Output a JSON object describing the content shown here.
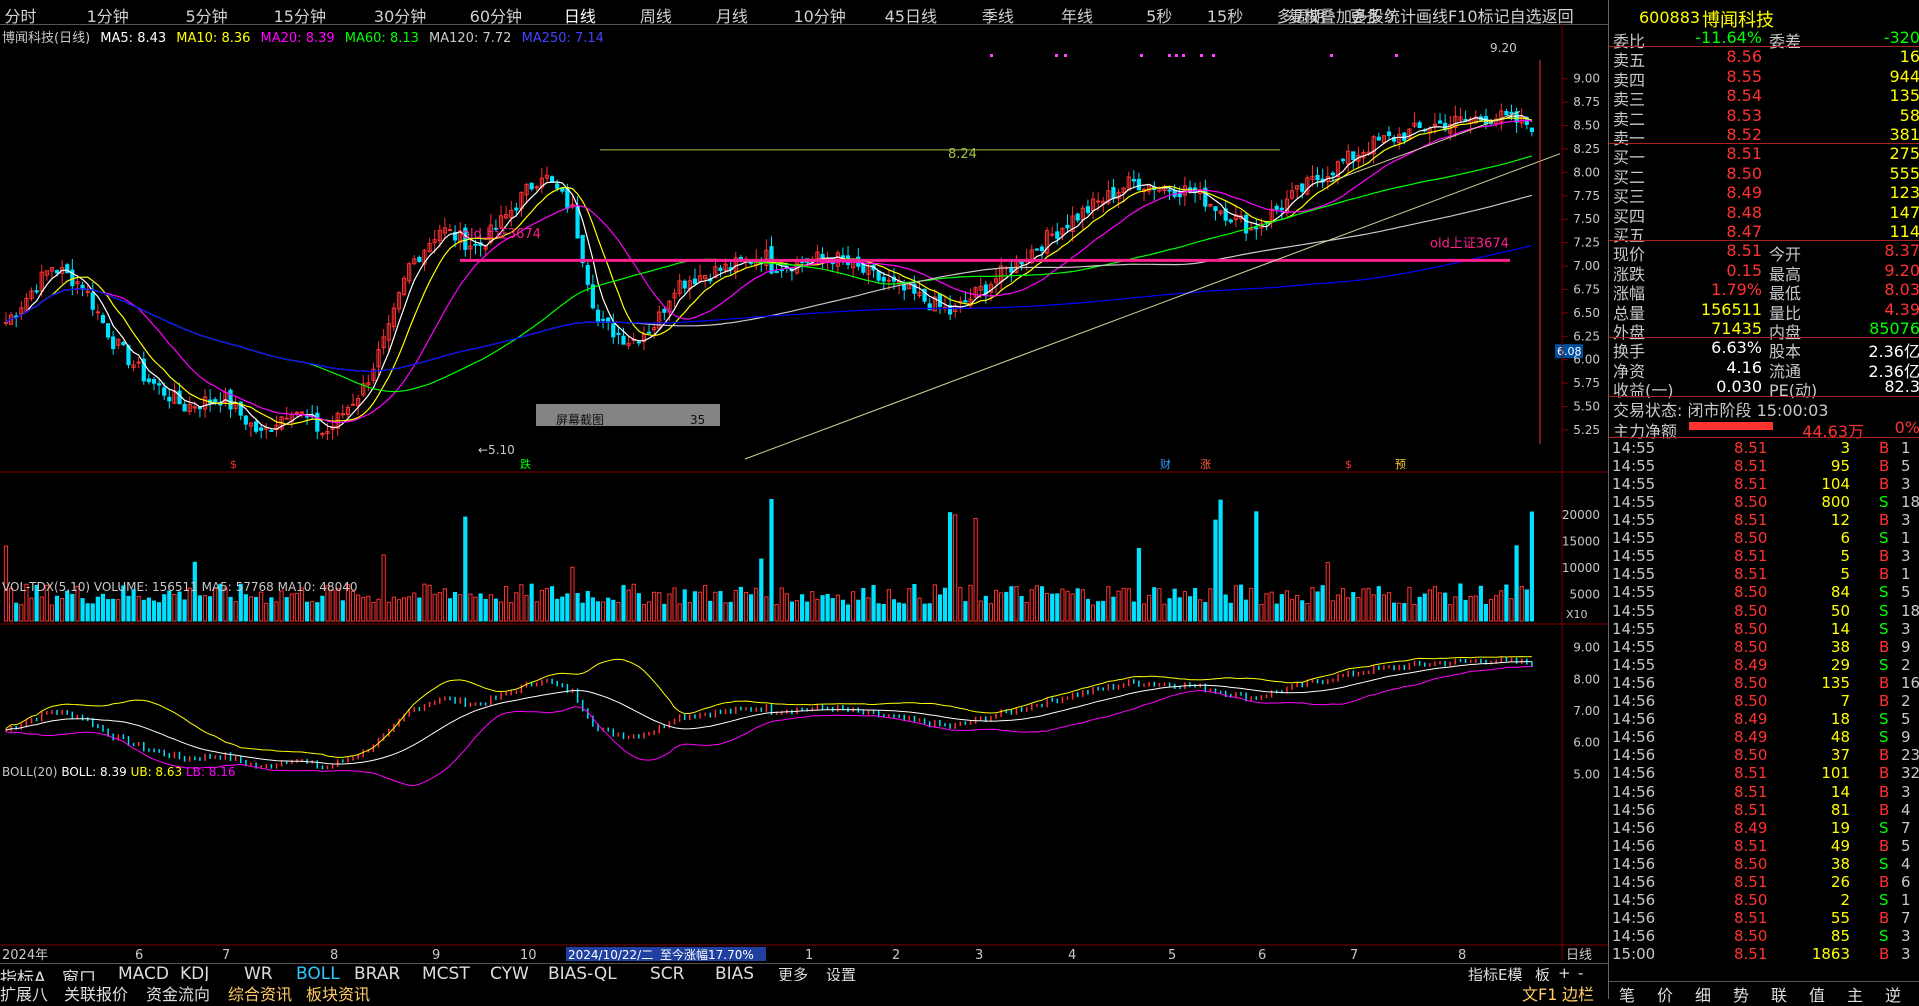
{
  "periods": [
    "分时",
    "1分钟",
    "5分钟",
    "15分钟",
    "30分钟",
    "60分钟",
    "日线",
    "周线",
    "月线",
    "10分钟",
    "45日线",
    "季线",
    "年线",
    "5秒",
    "15秒",
    "多周期",
    "更多 〉"
  ],
  "active_period": "日线",
  "top_right": "复权叠加多股统计画线F10标记自选返回",
  "stock": {
    "code": "600883",
    "name": "博闻科技"
  },
  "ma_legend": {
    "title": "博闻科技(日线)",
    "ma5": "MA5: 8.43",
    "ma10": "MA10: 8.36",
    "ma20": "MA20: 8.39",
    "ma60": "MA60: 8.13",
    "ma120": "MA120: 7.72",
    "ma250": "MA250: 7.14"
  },
  "annotations": {
    "level": "8.24",
    "old1": "old上证3674",
    "old2": "old上证3674",
    "screenshot": "屏幕截图",
    "screenshot_num": "35",
    "high": "9.20",
    "low": "5.10",
    "price_tag": "6.08",
    "range_text": "2024/10/22/二",
    "range_gain": "至今涨幅17.70%",
    "x10": "X10",
    "daily": "日线"
  },
  "event_marks": [
    "$",
    "跌",
    "财",
    "涨",
    "$",
    "预"
  ],
  "vol_legend": "VOL-TDX(5,10) VOLUME: 156511 MA5: 57768 MA10: 48040",
  "boll_legend": {
    "name": "BOLL(20)",
    "boll": "BOLL: 8.39",
    "ub": "UB: 8.63",
    "lb": "LB: 8.16"
  },
  "price_axis": [
    "9.00",
    "8.75",
    "8.50",
    "8.25",
    "8.00",
    "7.75",
    "7.50",
    "7.25",
    "7.00",
    "6.75",
    "6.50",
    "6.25",
    "6.00",
    "5.75",
    "5.50",
    "5.25"
  ],
  "vol_axis": [
    "20000",
    "15000",
    "10000",
    "5000"
  ],
  "boll_axis": [
    "9.00",
    "8.00",
    "7.00",
    "6.00",
    "5.00"
  ],
  "x_axis": [
    "2024年",
    "6",
    "7",
    "8",
    "9",
    "10",
    "1",
    "2",
    "3",
    "4",
    "5",
    "6",
    "7",
    "8"
  ],
  "bottom_tabs": [
    "指标A",
    "窗口",
    "MACD",
    "KDJ",
    "WR",
    "BOLL",
    "BRAR",
    "MCST",
    "CYW",
    "BIAS-QL",
    "SCR",
    "BIAS",
    "更多",
    "设置"
  ],
  "active_tab": "BOLL",
  "bottom_tabs2": [
    "扩展八",
    "关联报价",
    "资金流向",
    "综合资讯",
    "板块资讯"
  ],
  "bottom_right": [
    "指标E模",
    "板",
    "+",
    "-"
  ],
  "bottom_right2": [
    "文F1",
    "边栏"
  ],
  "order_book": {
    "weibi": {
      "label": "委比",
      "pct": "-11.64%",
      "label2": "委差",
      "val": "-320"
    },
    "asks": [
      {
        "l": "卖五",
        "p": "8.56",
        "v": "16"
      },
      {
        "l": "卖四",
        "p": "8.55",
        "v": "944"
      },
      {
        "l": "卖三",
        "p": "8.54",
        "v": "135"
      },
      {
        "l": "卖二",
        "p": "8.53",
        "v": "58"
      },
      {
        "l": "卖一",
        "p": "8.52",
        "v": "381"
      }
    ],
    "bids": [
      {
        "l": "买一",
        "p": "8.51",
        "v": "275"
      },
      {
        "l": "买二",
        "p": "8.50",
        "v": "555"
      },
      {
        "l": "买三",
        "p": "8.49",
        "v": "123"
      },
      {
        "l": "买四",
        "p": "8.48",
        "v": "147"
      },
      {
        "l": "买五",
        "p": "8.47",
        "v": "114"
      }
    ]
  },
  "quote": [
    {
      "a": "现价",
      "av": "8.51",
      "b": "今开",
      "bv": "8.37"
    },
    {
      "a": "涨跌",
      "av": "0.15",
      "b": "最高",
      "bv": "9.20"
    },
    {
      "a": "涨幅",
      "av": "1.79%",
      "b": "最低",
      "bv": "8.03"
    },
    {
      "a": "总量",
      "av": "156511",
      "b": "量比",
      "bv": "4.39"
    },
    {
      "a": "外盘",
      "av": "71435",
      "b": "内盘",
      "bv": "85076"
    }
  ],
  "fund": [
    {
      "a": "换手",
      "av": "6.63%",
      "b": "股本",
      "bv": "2.36亿"
    },
    {
      "a": "净资",
      "av": "4.16",
      "b": "流通",
      "bv": "2.36亿"
    },
    {
      "a": "收益(一)",
      "av": "0.030",
      "b": "PE(动)",
      "bv": "82.3"
    }
  ],
  "status": "交易状态: 闭市阶段 15:00:03",
  "main_flow": {
    "label": "主力净额",
    "val": "44.63万",
    "pct": "0%"
  },
  "ticks": [
    [
      "14:55",
      "8.51",
      "3",
      "B",
      "1"
    ],
    [
      "14:55",
      "8.51",
      "95",
      "B",
      "5"
    ],
    [
      "14:55",
      "8.51",
      "104",
      "B",
      "3"
    ],
    [
      "14:55",
      "8.50",
      "800",
      "S",
      "18"
    ],
    [
      "14:55",
      "8.51",
      "12",
      "B",
      "3"
    ],
    [
      "14:55",
      "8.50",
      "6",
      "S",
      "1"
    ],
    [
      "14:55",
      "8.51",
      "5",
      "B",
      "3"
    ],
    [
      "14:55",
      "8.51",
      "5",
      "B",
      "1"
    ],
    [
      "14:55",
      "8.50",
      "84",
      "S",
      "5"
    ],
    [
      "14:55",
      "8.50",
      "50",
      "S",
      "18"
    ],
    [
      "14:55",
      "8.50",
      "14",
      "S",
      "3"
    ],
    [
      "14:55",
      "8.50",
      "38",
      "B",
      "9"
    ],
    [
      "14:55",
      "8.49",
      "29",
      "S",
      "2"
    ],
    [
      "14:56",
      "8.50",
      "135",
      "B",
      "16"
    ],
    [
      "14:56",
      "8.50",
      "7",
      "B",
      "2"
    ],
    [
      "14:56",
      "8.49",
      "18",
      "S",
      "5"
    ],
    [
      "14:56",
      "8.49",
      "48",
      "S",
      "9"
    ],
    [
      "14:56",
      "8.50",
      "37",
      "B",
      "23"
    ],
    [
      "14:56",
      "8.51",
      "101",
      "B",
      "32"
    ],
    [
      "14:56",
      "8.51",
      "14",
      "B",
      "3"
    ],
    [
      "14:56",
      "8.51",
      "81",
      "B",
      "4"
    ],
    [
      "14:56",
      "8.49",
      "19",
      "S",
      "7"
    ],
    [
      "14:56",
      "8.51",
      "49",
      "B",
      "5"
    ],
    [
      "14:56",
      "8.50",
      "38",
      "S",
      "4"
    ],
    [
      "14:56",
      "8.51",
      "26",
      "B",
      "6"
    ],
    [
      "14:56",
      "8.50",
      "2",
      "S",
      "1"
    ],
    [
      "14:56",
      "8.51",
      "55",
      "B",
      "7"
    ],
    [
      "14:56",
      "8.50",
      "85",
      "S",
      "3"
    ],
    [
      "15:00",
      "8.51",
      "1863",
      "B",
      "3"
    ]
  ],
  "rp_bottom": [
    "笔",
    "价",
    "细",
    "势",
    "联",
    "值",
    "主",
    "逆"
  ],
  "colors": {
    "up": "#ff3232",
    "down": "#00e0ff",
    "ma5": "#ffffff",
    "ma10": "#ffff00",
    "ma20": "#ff00ff",
    "ma60": "#00ff00",
    "ma120": "#c8c8c8",
    "ma250": "#0000ff",
    "vol": "#ffffff"
  }
}
